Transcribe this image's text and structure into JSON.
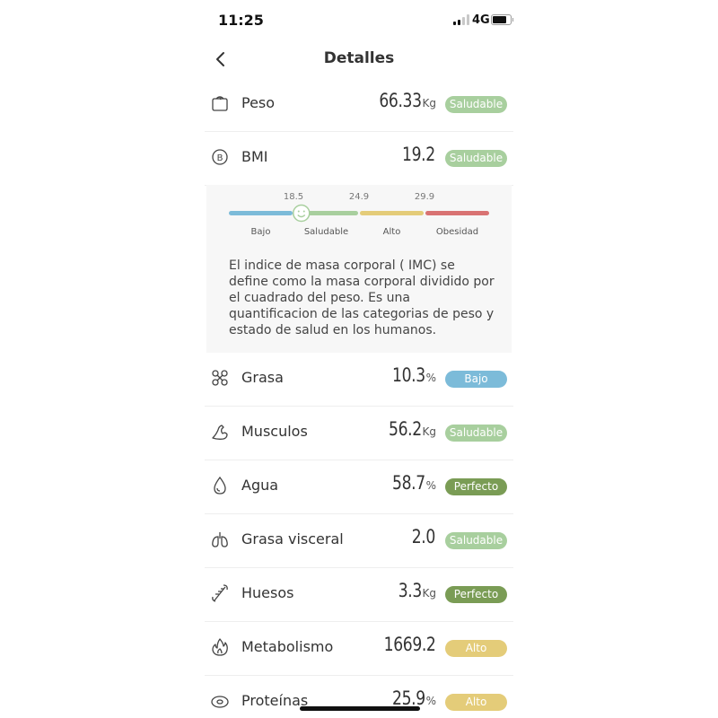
{
  "status_bar": {
    "time": "11:25",
    "network": "4G"
  },
  "header": {
    "title": "Detalles"
  },
  "metrics": {
    "peso": {
      "label": "Peso",
      "value": "66.33",
      "unit": "Kg",
      "status": "Saludable",
      "icon": "scale-icon"
    },
    "bmi": {
      "label": "BMI",
      "value": "19.2",
      "unit": "",
      "status": "Saludable",
      "icon": "bmi-icon"
    },
    "grasa": {
      "label": "Grasa",
      "value": "10.3",
      "unit": "%",
      "status": "Bajo",
      "icon": "fat-icon"
    },
    "musculos": {
      "label": "Musculos",
      "value": "56.2",
      "unit": "Kg",
      "status": "Saludable",
      "icon": "muscle-arm-icon"
    },
    "agua": {
      "label": "Agua",
      "value": "58.7",
      "unit": "%",
      "status": "Perfecto",
      "icon": "water-drop-icon"
    },
    "grasa_visceral": {
      "label": "Grasa visceral",
      "value": "2.0",
      "unit": "",
      "status": "Saludable",
      "icon": "lungs-icon"
    },
    "huesos": {
      "label": "Huesos",
      "value": "3.3",
      "unit": "Kg",
      "status": "Perfecto",
      "icon": "bone-icon"
    },
    "metabolismo": {
      "label": "Metabolismo",
      "value": "1669.2",
      "unit": "",
      "status": "Alto",
      "icon": "flame-icon"
    },
    "proteinas": {
      "label": "Proteínas",
      "value": "25.9",
      "unit": "%",
      "status": "Alto",
      "icon": "protein-icon"
    }
  },
  "bmi_scale": {
    "thresholds": [
      "18.5",
      "24.9",
      "29.9"
    ],
    "categories": [
      "Bajo",
      "Saludable",
      "Alto",
      "Obesidad"
    ],
    "colors": [
      "#7cbbd9",
      "#a8cf9e",
      "#e4cc79",
      "#d97373"
    ],
    "current_value": 19.2
  },
  "bmi_description": "El indice de masa corporal ( IMC) se define como la masa corporal dividido por el cuadrado del peso. Es una quantificacion de las categorias de peso y estado de salud en los humanos."
}
